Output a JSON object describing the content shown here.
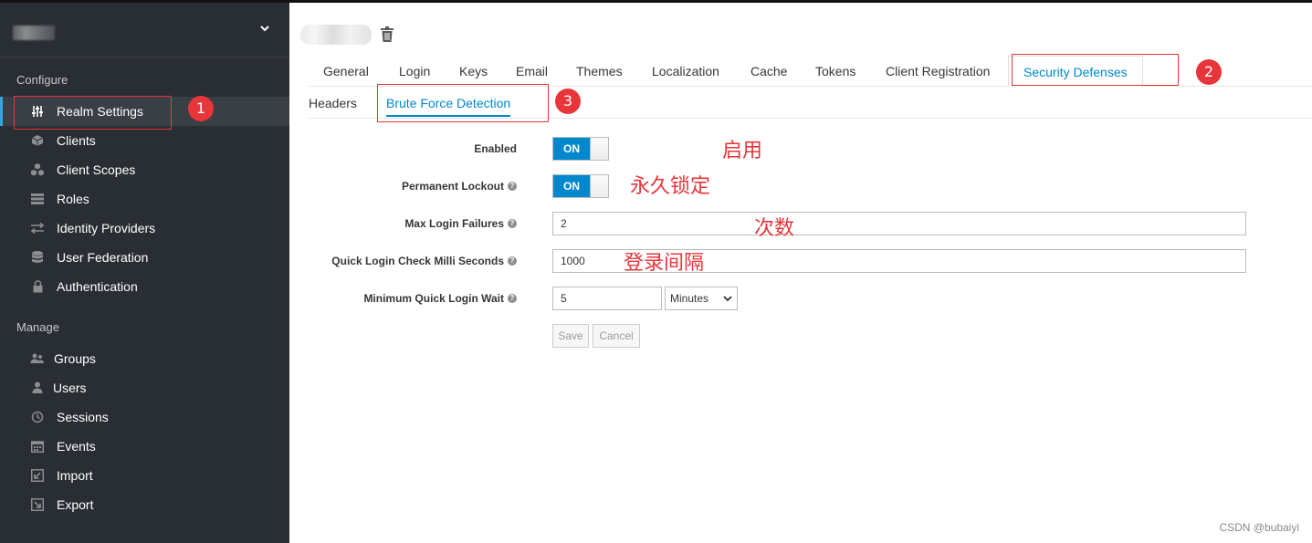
{
  "sidebar": {
    "chevron": "⌄",
    "configure_title": "Configure",
    "manage_title": "Manage",
    "configure_items": [
      {
        "label": "Realm Settings",
        "icon": "sliders-icon"
      },
      {
        "label": "Clients",
        "icon": "cube-icon"
      },
      {
        "label": "Client Scopes",
        "icon": "cubes-icon"
      },
      {
        "label": "Roles",
        "icon": "list-icon"
      },
      {
        "label": "Identity Providers",
        "icon": "exchange-icon"
      },
      {
        "label": "User Federation",
        "icon": "database-icon"
      },
      {
        "label": "Authentication",
        "icon": "lock-icon"
      }
    ],
    "manage_items": [
      {
        "label": "Groups",
        "icon": "users-icon"
      },
      {
        "label": "Users",
        "icon": "user-icon"
      },
      {
        "label": "Sessions",
        "icon": "clock-icon"
      },
      {
        "label": "Events",
        "icon": "calendar-icon"
      },
      {
        "label": "Import",
        "icon": "import-icon"
      },
      {
        "label": "Export",
        "icon": "export-icon"
      }
    ]
  },
  "tabs": [
    "General",
    "Login",
    "Keys",
    "Email",
    "Themes",
    "Localization",
    "Cache",
    "Tokens",
    "Client Registration",
    "Security Defenses"
  ],
  "subtabs": [
    "Headers",
    "Brute Force Detection"
  ],
  "form": {
    "enabled_label": "Enabled",
    "enabled_value": "ON",
    "permanent_lockout_label": "Permanent Lockout",
    "permanent_lockout_value": "ON",
    "max_login_failures_label": "Max Login Failures",
    "max_login_failures_value": "2",
    "quick_login_check_label": "Quick Login Check Milli Seconds",
    "quick_login_check_value": "1000",
    "min_quick_login_wait_label": "Minimum Quick Login Wait",
    "min_quick_login_wait_value": "5",
    "min_quick_login_wait_unit": "Minutes",
    "save_label": "Save",
    "cancel_label": "Cancel"
  },
  "annotations": {
    "num1": "1",
    "num2": "2",
    "num3": "3",
    "enabled_note": "启用",
    "permanent_note": "永久锁定",
    "failures_note": "次数",
    "interval_note": "登录间隔"
  },
  "watermark": "CSDN @bubaiyi",
  "colors": {
    "sidebar_bg": "#292e34",
    "accent": "#0088ce",
    "annotation_red": "#e8353a"
  }
}
